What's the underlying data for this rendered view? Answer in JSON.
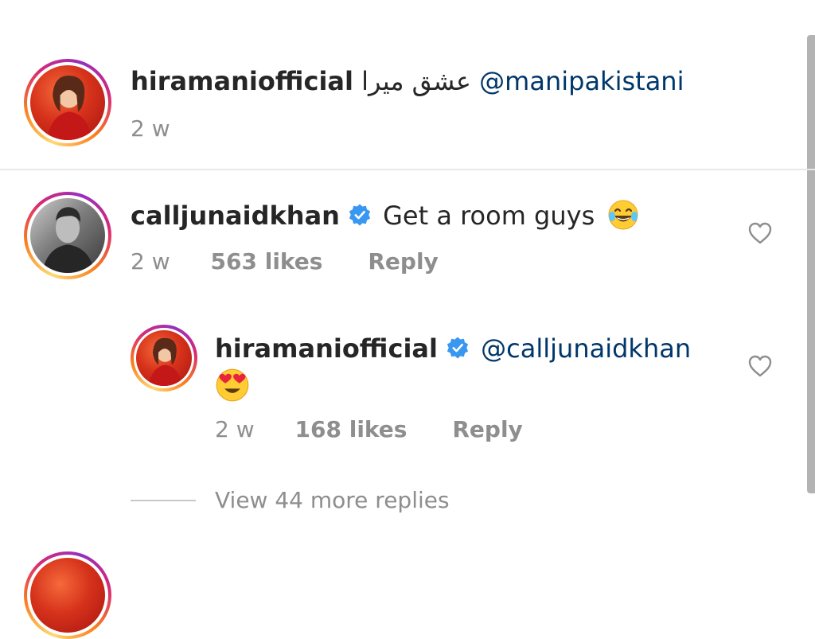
{
  "caption": {
    "username": "hiramaniofficial",
    "urdu_text": "عشق میرا",
    "mention": "@manipakistani",
    "time": "2 w"
  },
  "comment": {
    "username": "calljunaidkhan",
    "text": "Get a room guys",
    "emoji": "face-with-tears-of-joy",
    "time": "2 w",
    "likes": "563 likes",
    "reply": "Reply"
  },
  "reply_comment": {
    "username": "hiramaniofficial",
    "mention": "@calljunaidkhan",
    "emoji": "smiling-face-with-heart-eyes",
    "time": "2 w",
    "likes": "168 likes",
    "reply": "Reply"
  },
  "view_more": {
    "label": "View 44 more replies"
  },
  "colors": {
    "verified": "#3897f0",
    "mention": "#00376b",
    "muted": "#8e8e8e"
  }
}
